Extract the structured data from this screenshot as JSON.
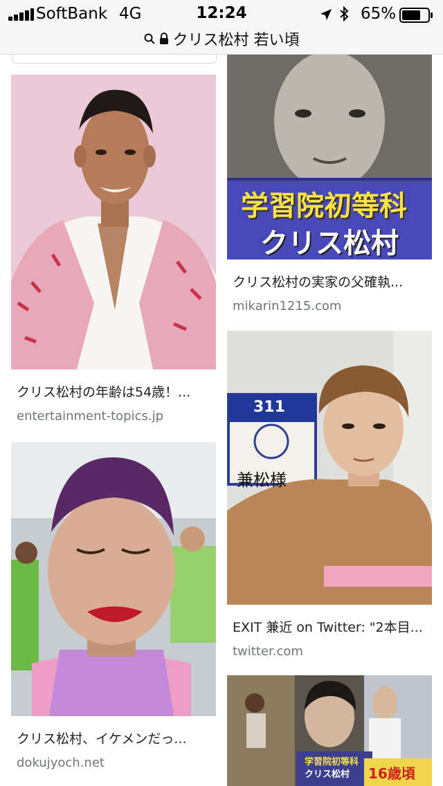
{
  "status_bar": {
    "carrier": "SoftBank",
    "network": "4G",
    "time": "12:24",
    "battery": "65%"
  },
  "url_bar": {
    "query": "クリス松村 若い頃"
  },
  "results": [
    {
      "caption": "クリス松村の年齢は54歳！...",
      "source": "entertainment-topics.jp"
    },
    {
      "caption": "クリス松村の実家の父確執...",
      "source": "mikarin1215.com",
      "image_texts": [
        "学習院初等科",
        "クリス松村"
      ]
    },
    {
      "caption": "EXIT 兼近 on Twitter: \"2本目...",
      "source": "twitter.com",
      "image_texts": [
        "311",
        "兼松様"
      ]
    },
    {
      "caption": "クリス松村、イケメンだっ...",
      "source": "dokujyoch.net"
    },
    {
      "image_texts": [
        "学習院初等科",
        "クリス松村",
        "16歳頃"
      ]
    }
  ]
}
